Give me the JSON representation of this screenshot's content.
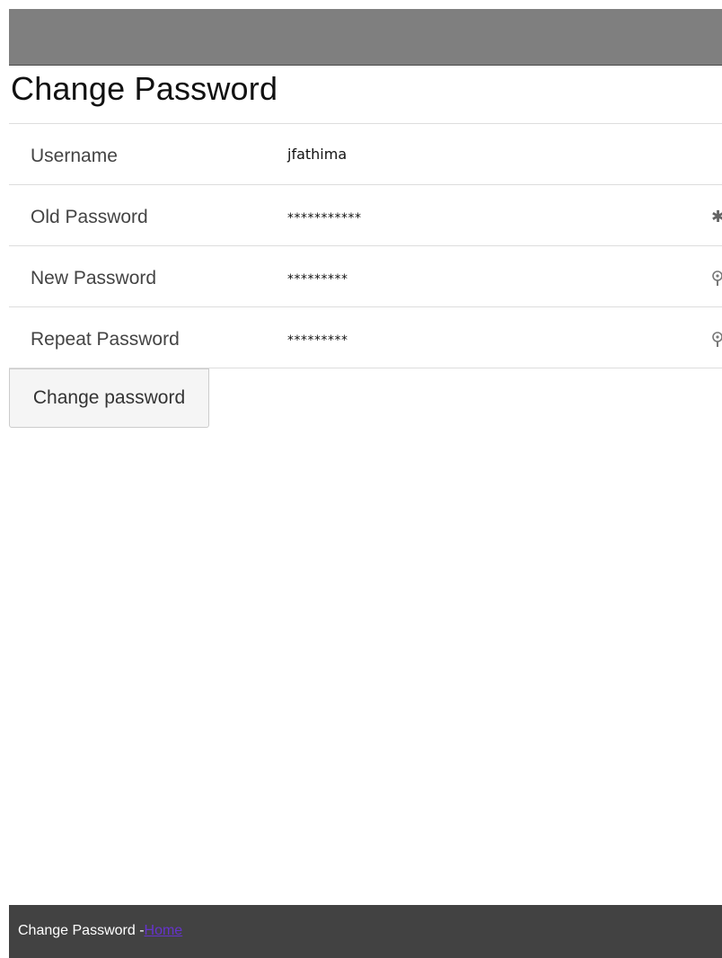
{
  "header": {
    "color": "#7f7f7f"
  },
  "page": {
    "title": "Change Password"
  },
  "form": {
    "rows": [
      {
        "label": "Username",
        "value": "jfathima",
        "icon": ""
      },
      {
        "label": "Old Password",
        "value": "***********",
        "icon": "asterisk-icon"
      },
      {
        "label": "New Password",
        "value": "*********",
        "icon": "key-icon"
      },
      {
        "label": "Repeat Password",
        "value": "*********",
        "icon": "key-icon"
      }
    ],
    "submit_label": "Change password"
  },
  "footer": {
    "text": "Change Password -",
    "link_label": "Home",
    "link_color": "#6633cc"
  }
}
